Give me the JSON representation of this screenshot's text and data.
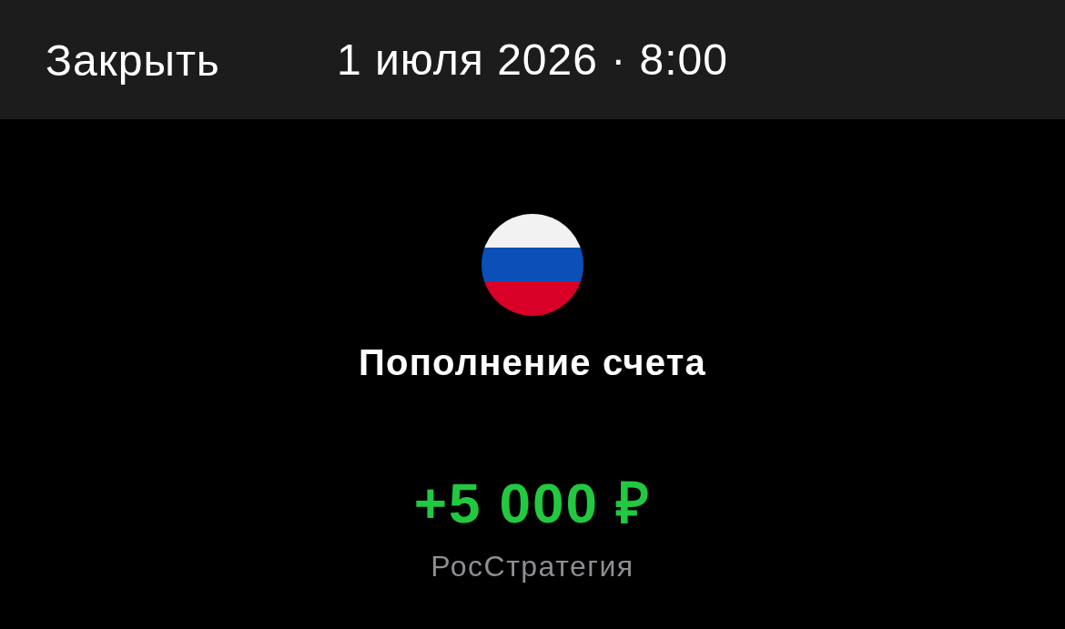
{
  "header": {
    "close_button": "Закрыть",
    "date": "1 июля 2026 · 8:00"
  },
  "operation": {
    "title": "Пополнение счета",
    "amount": "+5 000 ₽",
    "counterparty": "РосСтратегия"
  }
}
